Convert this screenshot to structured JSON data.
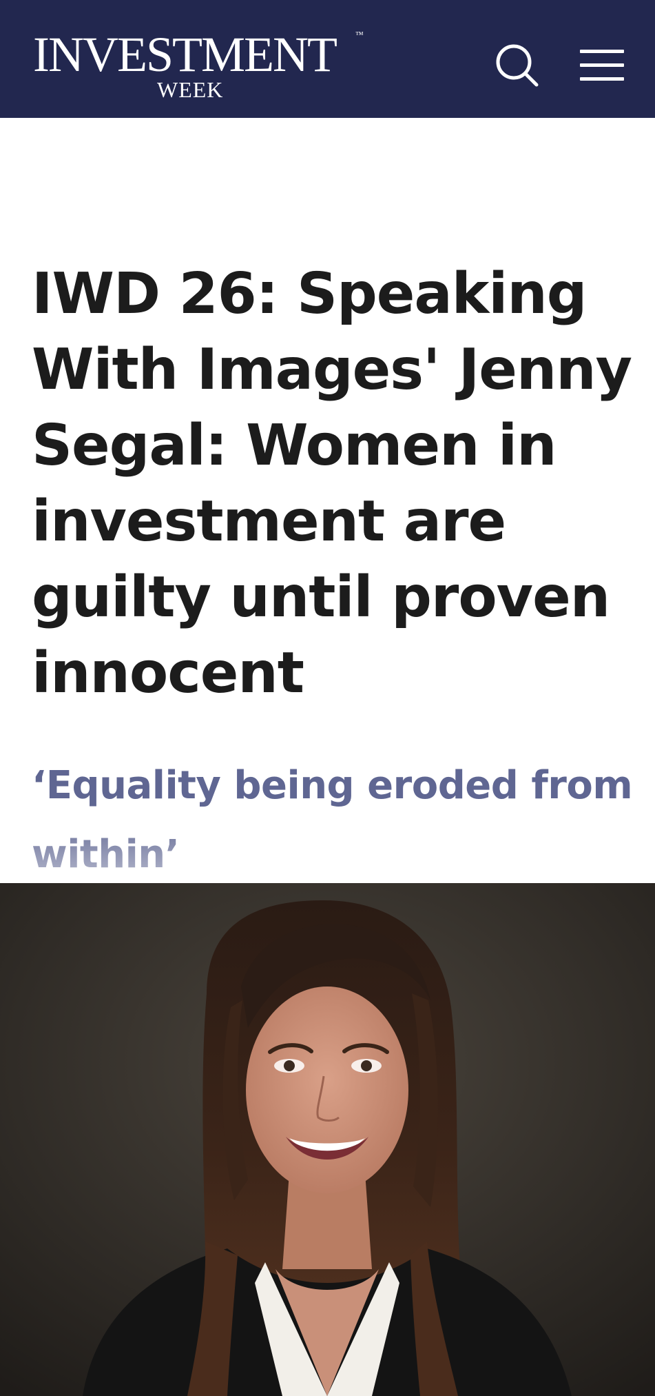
{
  "header": {
    "logo_main": "INVESTMENT",
    "logo_tm": "™",
    "logo_sub": "WEEK",
    "search_icon": "search-icon",
    "menu_icon": "hamburger-menu-icon",
    "background_color": "#22274f"
  },
  "article": {
    "headline": "IWD 26: Speaking With Images' Jenny Segal: Women in investment are guilty until proven innocent",
    "standfirst": "‘Equality being eroded from within’",
    "standfirst_color": "#5f6692"
  }
}
